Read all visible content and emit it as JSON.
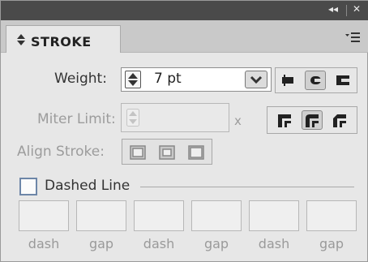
{
  "panel": {
    "title": "STROKE",
    "titlebar": {
      "collapse": "◂◂",
      "close": "✕"
    }
  },
  "weight": {
    "label": "Weight:",
    "value": "7 pt"
  },
  "miter": {
    "label": "Miter Limit:",
    "value": "",
    "suffix": "x"
  },
  "align": {
    "label": "Align Stroke:"
  },
  "dashed": {
    "label": "Dashed Line",
    "checked": false
  },
  "dash_fields": [
    {
      "label": "dash",
      "value": ""
    },
    {
      "label": "gap",
      "value": ""
    },
    {
      "label": "dash",
      "value": ""
    },
    {
      "label": "gap",
      "value": ""
    },
    {
      "label": "dash",
      "value": ""
    },
    {
      "label": "gap",
      "value": ""
    }
  ],
  "icons": {
    "cap": [
      "butt-cap-icon",
      "round-cap-icon",
      "projecting-cap-icon"
    ],
    "join": [
      "miter-join-icon",
      "round-join-icon",
      "bevel-join-icon"
    ],
    "align": [
      "align-center-icon",
      "align-inside-icon",
      "align-outside-icon"
    ]
  }
}
